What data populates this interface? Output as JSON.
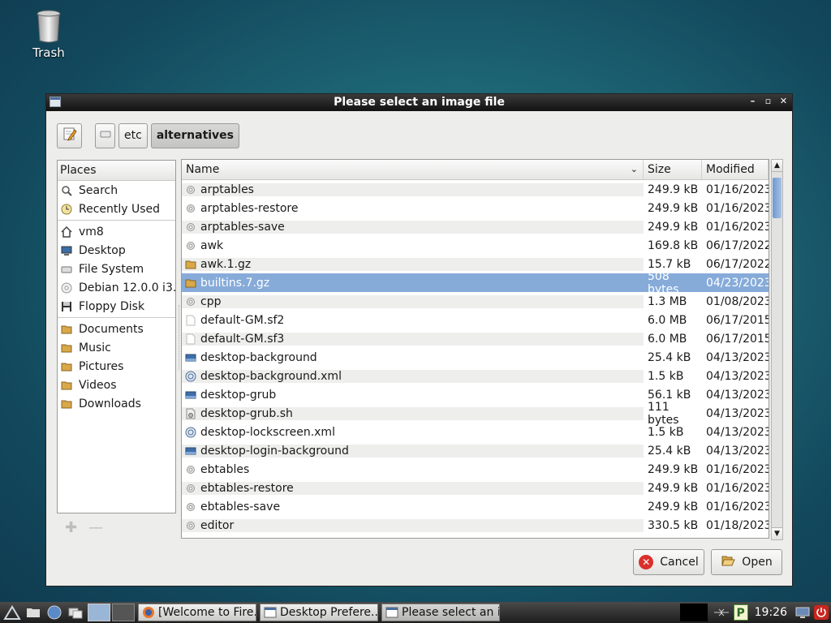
{
  "desktop": {
    "trash_label": "Trash"
  },
  "dialog": {
    "title": "Please select an image file",
    "path": [
      "etc",
      "alternatives"
    ],
    "places_header": "Places",
    "places": [
      {
        "label": "Search",
        "icon": "search-icon"
      },
      {
        "label": "Recently Used",
        "icon": "clock-icon"
      },
      {
        "label": "vm8",
        "icon": "home-icon"
      },
      {
        "label": "Desktop",
        "icon": "desktop-icon"
      },
      {
        "label": "File System",
        "icon": "drive-icon"
      },
      {
        "label": "Debian 12.0.0 i3...",
        "icon": "disc-icon"
      },
      {
        "label": "Floppy Disk",
        "icon": "floppy-icon"
      },
      {
        "label": "Documents",
        "icon": "folder-icon"
      },
      {
        "label": "Music",
        "icon": "folder-icon"
      },
      {
        "label": "Pictures",
        "icon": "folder-icon"
      },
      {
        "label": "Videos",
        "icon": "folder-icon"
      },
      {
        "label": "Downloads",
        "icon": "folder-icon"
      }
    ],
    "columns": {
      "name": "Name",
      "size": "Size",
      "modified": "Modified"
    },
    "files": [
      {
        "name": "arptables",
        "size": "249.9 kB",
        "modified": "01/16/2023",
        "icon": "gear-icon"
      },
      {
        "name": "arptables-restore",
        "size": "249.9 kB",
        "modified": "01/16/2023",
        "icon": "gear-icon"
      },
      {
        "name": "arptables-save",
        "size": "249.9 kB",
        "modified": "01/16/2023",
        "icon": "gear-icon"
      },
      {
        "name": "awk",
        "size": "169.8 kB",
        "modified": "06/17/2022",
        "icon": "gear-icon"
      },
      {
        "name": "awk.1.gz",
        "size": "15.7 kB",
        "modified": "06/17/2022",
        "icon": "archive-icon"
      },
      {
        "name": "builtins.7.gz",
        "size": "508 bytes",
        "modified": "04/23/2023",
        "icon": "archive-icon",
        "selected": true
      },
      {
        "name": "cpp",
        "size": "1.3 MB",
        "modified": "01/08/2023",
        "icon": "gear-icon"
      },
      {
        "name": "default-GM.sf2",
        "size": "6.0 MB",
        "modified": "06/17/2015",
        "icon": "file-icon"
      },
      {
        "name": "default-GM.sf3",
        "size": "6.0 MB",
        "modified": "06/17/2015",
        "icon": "file-icon"
      },
      {
        "name": "desktop-background",
        "size": "25.4 kB",
        "modified": "04/13/2023",
        "icon": "image-icon"
      },
      {
        "name": "desktop-background.xml",
        "size": "1.5 kB",
        "modified": "04/13/2023",
        "icon": "xml-icon"
      },
      {
        "name": "desktop-grub",
        "size": "56.1 kB",
        "modified": "04/13/2023",
        "icon": "image-icon"
      },
      {
        "name": "desktop-grub.sh",
        "size": "111 bytes",
        "modified": "04/13/2023",
        "icon": "script-icon"
      },
      {
        "name": "desktop-lockscreen.xml",
        "size": "1.5 kB",
        "modified": "04/13/2023",
        "icon": "xml-icon"
      },
      {
        "name": "desktop-login-background",
        "size": "25.4 kB",
        "modified": "04/13/2023",
        "icon": "image-icon"
      },
      {
        "name": "ebtables",
        "size": "249.9 kB",
        "modified": "01/16/2023",
        "icon": "gear-icon"
      },
      {
        "name": "ebtables-restore",
        "size": "249.9 kB",
        "modified": "01/16/2023",
        "icon": "gear-icon"
      },
      {
        "name": "ebtables-save",
        "size": "249.9 kB",
        "modified": "01/16/2023",
        "icon": "gear-icon"
      },
      {
        "name": "editor",
        "size": "330.5 kB",
        "modified": "01/18/2023",
        "icon": "gear-icon"
      }
    ],
    "cancel_label": "Cancel",
    "open_label": "Open"
  },
  "taskbar": {
    "tasks": [
      {
        "label": "[Welcome to Fire...",
        "icon": "firefox-icon"
      },
      {
        "label": "Desktop Prefere...",
        "icon": "window-icon"
      },
      {
        "label": "Please select an i...",
        "icon": "window-icon"
      }
    ],
    "clock": "19:26"
  }
}
